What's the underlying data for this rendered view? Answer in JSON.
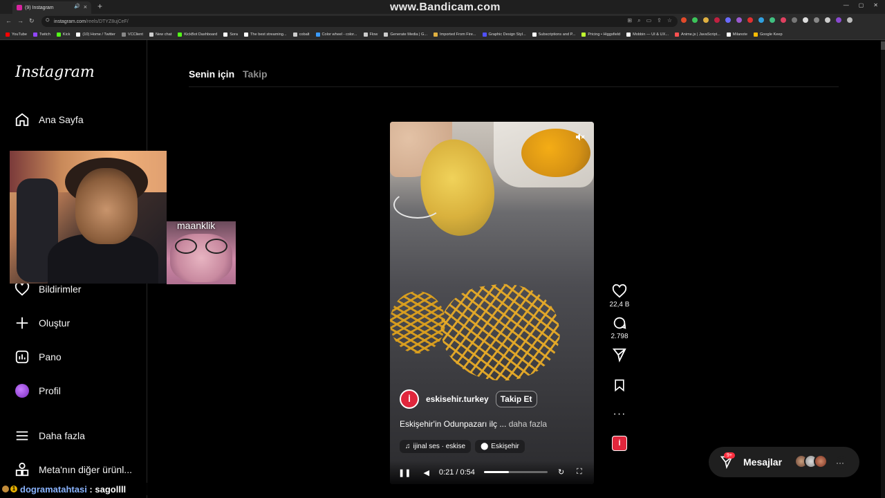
{
  "browser": {
    "tab_title": "(9) Instagram",
    "url_host": "instagram.com",
    "url_path": "/reels/DTYZ8ujCeF/",
    "watermark": "www.Bandicam.com",
    "bookmarks": [
      {
        "label": "YouTube",
        "color": "#ff0000"
      },
      {
        "label": "Twitch",
        "color": "#9146ff"
      },
      {
        "label": "Kick",
        "color": "#53fc18"
      },
      {
        "label": "(10) Home / Twitter",
        "color": "#ffffff"
      },
      {
        "label": "VCClient",
        "color": "#888888"
      },
      {
        "label": "New chat",
        "color": "#cccccc"
      },
      {
        "label": "KickBot Dashboard",
        "color": "#53fc18"
      },
      {
        "label": "Sora",
        "color": "#ffffff"
      },
      {
        "label": "The best streaming...",
        "color": "#ffffff"
      },
      {
        "label": "cobalt",
        "color": "#cccccc"
      },
      {
        "label": "Color wheel - color...",
        "color": "#3a9bff"
      },
      {
        "label": "Flow",
        "color": "#cccccc"
      },
      {
        "label": "Generate Media | G...",
        "color": "#cccccc"
      },
      {
        "label": "Imported From Fire...",
        "color": "#e0b040"
      },
      {
        "label": "Graphic Design Styl...",
        "color": "#5050ff"
      },
      {
        "label": "Subscriptions and P...",
        "color": "#ffffff"
      },
      {
        "label": "Pricing • Higgsfield",
        "color": "#c0ff30"
      },
      {
        "label": "Mobbin — UI & UX...",
        "color": "#ffffff"
      },
      {
        "label": "Anime.js | JavaScript...",
        "color": "#ff5050"
      },
      {
        "label": "Milanote",
        "color": "#ffffff"
      },
      {
        "label": "Google Keep",
        "color": "#fbbc04"
      }
    ]
  },
  "instagram": {
    "logo": "Instagram",
    "nav": {
      "home": "Ana Sayfa",
      "notifications": "Bildirimler",
      "create": "Oluştur",
      "dashboard": "Pano",
      "profile": "Profil",
      "more": "Daha fazla",
      "meta": "Meta'nın diğer ürünl..."
    },
    "feed_tabs": {
      "for_you": "Senin için",
      "following": "Takip"
    },
    "reel": {
      "username": "eskisehir.turkey",
      "follow_label": "Takip Et",
      "caption": "Eskişehir'in Odunpazarı ilç ...",
      "caption_more": "daha fazla",
      "audio": "ijinal ses · eskise",
      "location": "Eskişehir",
      "time_current": "0:21",
      "time_total": "0:54",
      "progress_fraction": 0.389,
      "likes": "22,4 B",
      "comments": "2.798"
    },
    "messages": {
      "label": "Mesajlar",
      "badge": "9+"
    }
  },
  "overlay": {
    "cam2_name": "maanklik",
    "chat_badge": "1",
    "chat_user": "dogramatahtasi",
    "chat_msg": "sagollll"
  }
}
